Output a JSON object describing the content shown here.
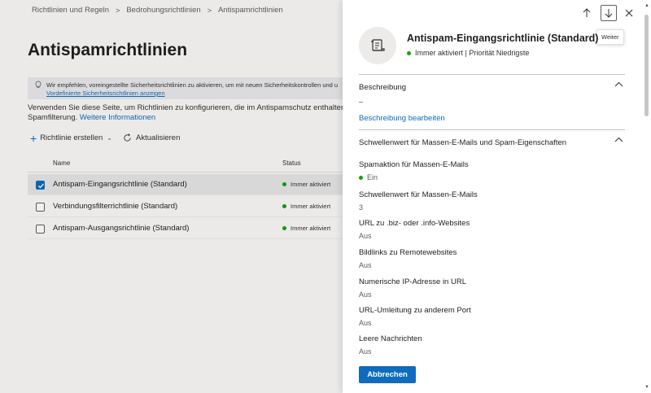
{
  "breadcrumb": [
    "Richtlinien und Regeln",
    "Bedrohungsrichtlinien",
    "Antispamrichtlinien"
  ],
  "page_title": "Antispamrichtlinien",
  "infobar": {
    "text": "Wir empfehlen, voreingestellte Sicherheitsrichtlinien zu aktivieren, um mit neuen Sicherheitskontrollen und u",
    "link": "Vordefinierte Sicherheitsrichtlinien anzeigen"
  },
  "description": {
    "line1": "Verwenden Sie diese Seite, um Richtlinien zu konfigurieren, die im Antispamschutz enthalten sind.",
    "line2": "Spamfilterung.",
    "link": "Weitere Informationen"
  },
  "toolbar": {
    "create": "Richtlinie erstellen",
    "refresh": "Aktualisieren"
  },
  "table": {
    "headers": {
      "name": "Name",
      "status": "Status"
    },
    "rows": [
      {
        "name": "Antispam-Eingangsrichtlinie (Standard)",
        "status": "Immer aktiviert"
      },
      {
        "name": "Verbindungsfilterrichtlinie (Standard)",
        "status": "Immer aktiviert"
      },
      {
        "name": "Antispam-Ausgangsrichtlinie (Standard)",
        "status": "Immer aktiviert"
      }
    ]
  },
  "panel": {
    "title": "Antispam-Eingangsrichtlinie (Standard)",
    "subtitle": "Immer aktiviert | Priorität Niedrigste",
    "tooltip": "Weiter",
    "sections": {
      "description": {
        "title": "Beschreibung",
        "value": "–",
        "edit_link": "Beschreibung bearbeiten"
      },
      "thresholds": {
        "title": "Schwellenwert für Massen-E-Mails und Spam-Eigenschaften",
        "fields": [
          {
            "label": "Spamaktion für Massen-E-Mails",
            "value": "Ein"
          },
          {
            "label": "Schwellenwert für Massen-E-Mails",
            "value": "3"
          },
          {
            "label": "URL zu .biz- oder .info-Websites",
            "value": "Aus"
          },
          {
            "label": "Bildlinks zu Remotewebsites",
            "value": "Aus"
          },
          {
            "label": "Numerische IP-Adresse in URL",
            "value": "Aus"
          },
          {
            "label": "URL-Umleitung zu anderem Port",
            "value": "Aus"
          },
          {
            "label": "Leere Nachrichten",
            "value": "Aus"
          }
        ]
      }
    },
    "cancel_label": "Abbrechen"
  },
  "colors": {
    "accent": "#0f6cbd",
    "status_green": "#13a10e"
  }
}
